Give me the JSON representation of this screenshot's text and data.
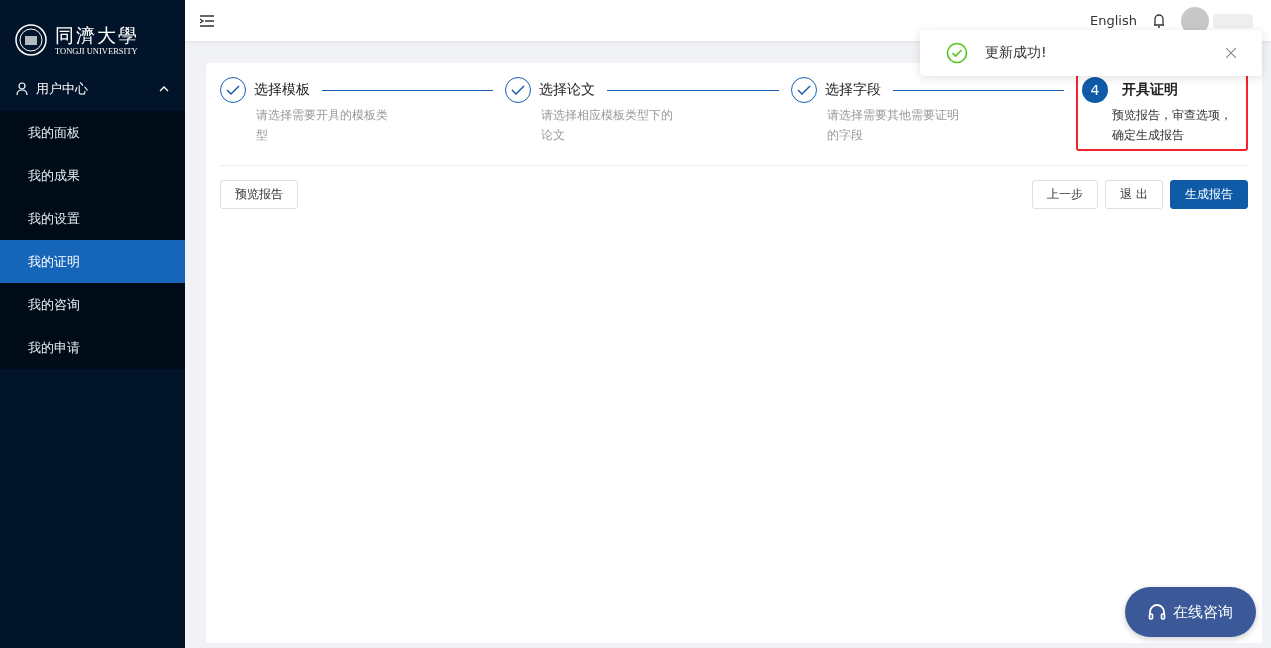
{
  "sidebar": {
    "logo": {
      "name": "同濟大學",
      "subtitle": "TONGJI UNIVERSITY"
    },
    "group": {
      "label": "用户中心",
      "expanded": true
    },
    "items": [
      {
        "label": "我的面板",
        "selected": false
      },
      {
        "label": "我的成果",
        "selected": false
      },
      {
        "label": "我的设置",
        "selected": false
      },
      {
        "label": "我的证明",
        "selected": true
      },
      {
        "label": "我的咨询",
        "selected": false
      },
      {
        "label": "我的申请",
        "selected": false
      }
    ]
  },
  "header": {
    "language": "English"
  },
  "toast": {
    "message": "更新成功!"
  },
  "steps": [
    {
      "title": "选择模板",
      "description": "请选择需要开具的模板类型",
      "done": true,
      "highlighted": false
    },
    {
      "title": "选择论文",
      "description": "请选择相应模板类型下的论文",
      "done": true,
      "highlighted": false
    },
    {
      "title": "选择字段",
      "description": "请选择需要其他需要证明的字段",
      "done": true,
      "highlighted": false
    },
    {
      "number": "4",
      "title": "开具证明",
      "description": "预览报告，审查选项，确定生成报告",
      "done": false,
      "highlighted": true
    }
  ],
  "actions": {
    "left": [
      {
        "label": "预览报告",
        "primary": false
      }
    ],
    "right": [
      {
        "label": "上一步",
        "primary": false
      },
      {
        "label": "退 出",
        "primary": false
      },
      {
        "label": "生成报告",
        "primary": true
      }
    ]
  },
  "chat_button": {
    "label": "在线咨询"
  }
}
